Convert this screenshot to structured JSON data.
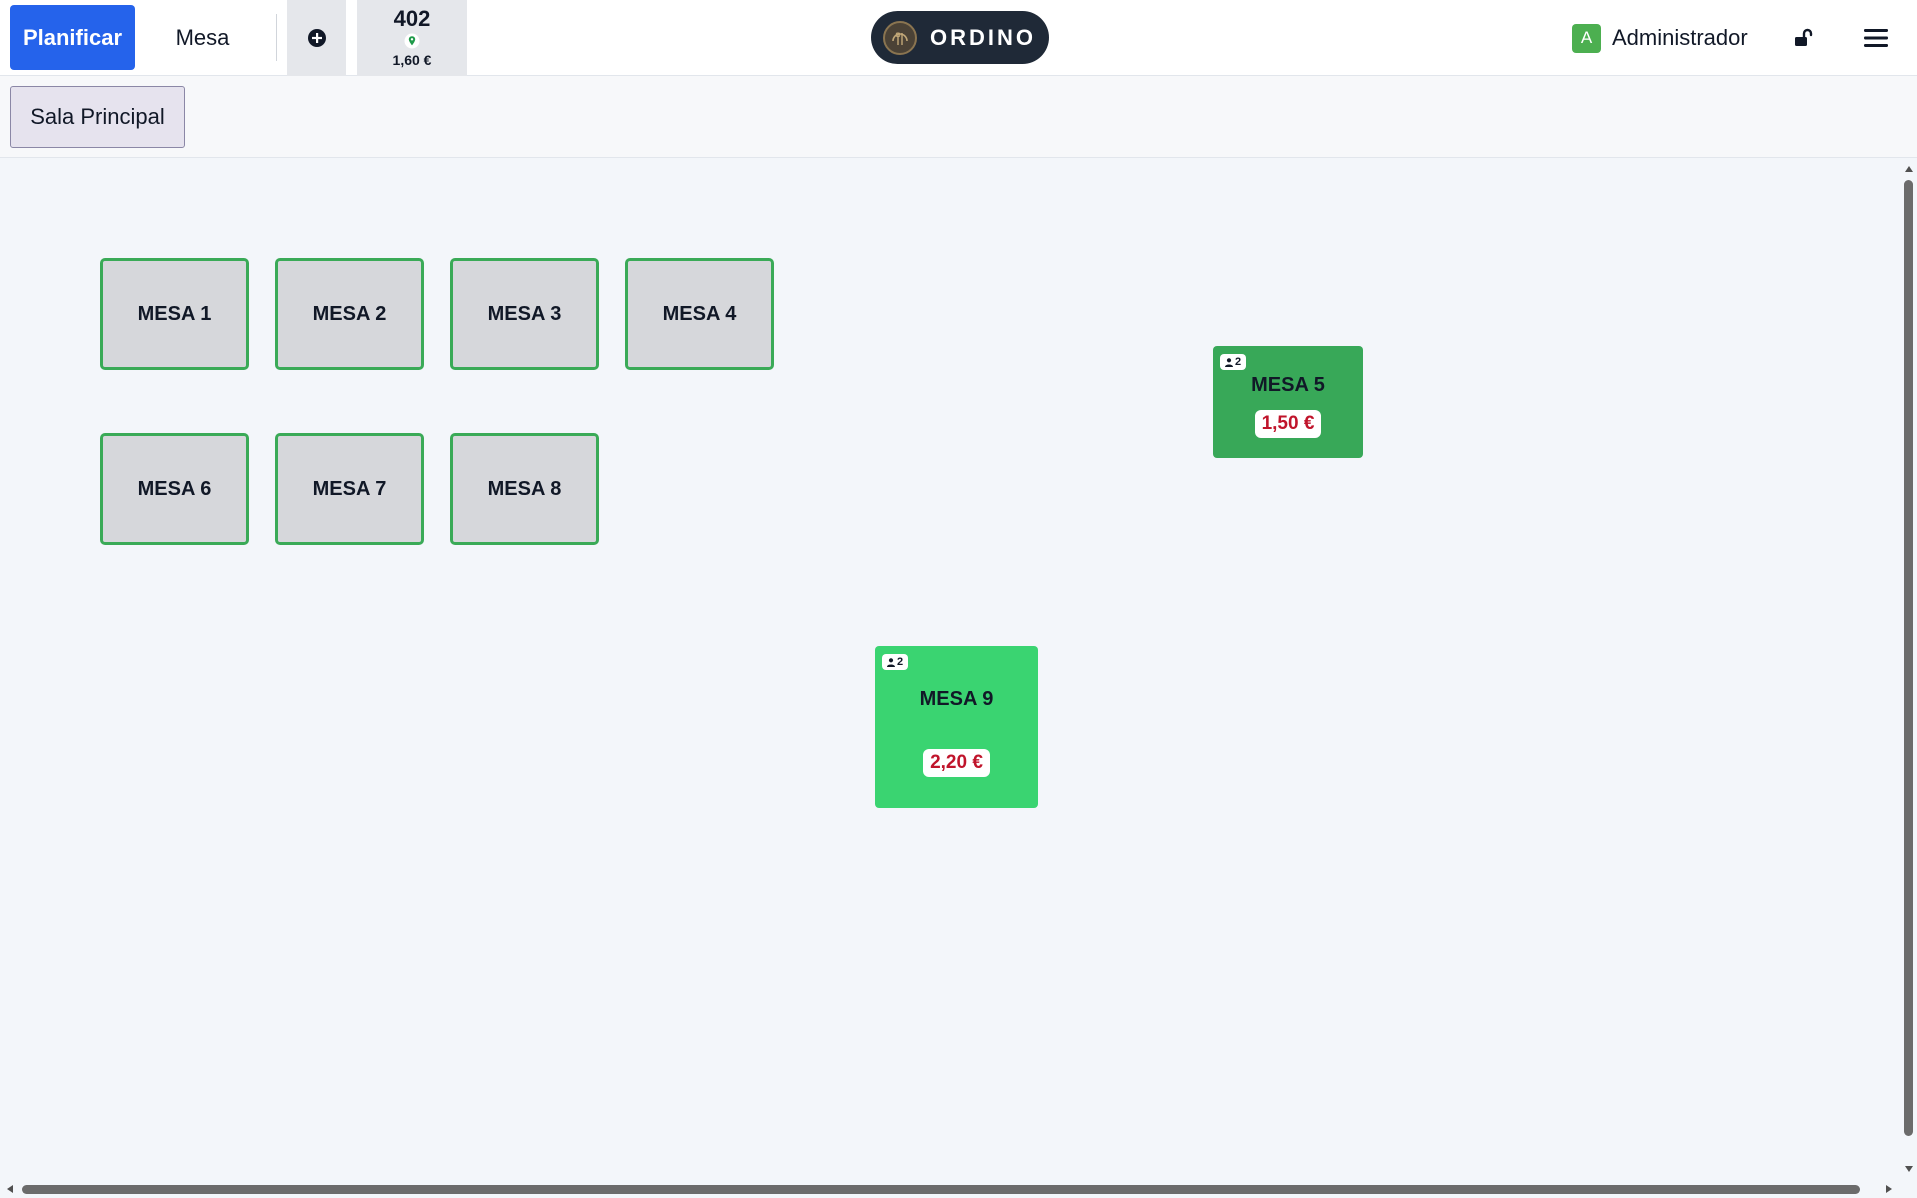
{
  "topbar": {
    "plan_label": "Planificar",
    "mode_label": "Mesa",
    "add_icon": "plus-circle-icon",
    "order": {
      "number": "402",
      "location_icon": "map-pin-icon",
      "total": "1,60 €"
    },
    "brand": "ORDINO",
    "user": {
      "initial": "A",
      "name": "Administrador"
    },
    "lock_icon": "unlocked-padlock-icon",
    "menu_icon": "hamburger-menu-icon"
  },
  "rooms": {
    "active": "Sala Principal"
  },
  "tables": [
    {
      "label": "MESA 1",
      "status": "free"
    },
    {
      "label": "MESA 2",
      "status": "free"
    },
    {
      "label": "MESA 3",
      "status": "free"
    },
    {
      "label": "MESA 4",
      "status": "free"
    },
    {
      "label": "MESA 5",
      "status": "occupied",
      "guests": "2",
      "total": "1,50 €",
      "color": "#38a858"
    },
    {
      "label": "MESA 6",
      "status": "free"
    },
    {
      "label": "MESA 7",
      "status": "free"
    },
    {
      "label": "MESA 8",
      "status": "free"
    },
    {
      "label": "MESA 9",
      "status": "occupied",
      "guests": "2",
      "total": "2,20 €",
      "color": "#3ad471"
    }
  ],
  "colors": {
    "primary": "#2563eb",
    "free_table_border": "#3aaa57",
    "free_table_fill": "#d6d7db",
    "price_text": "#c0142b",
    "avatar": "#4caf50"
  }
}
